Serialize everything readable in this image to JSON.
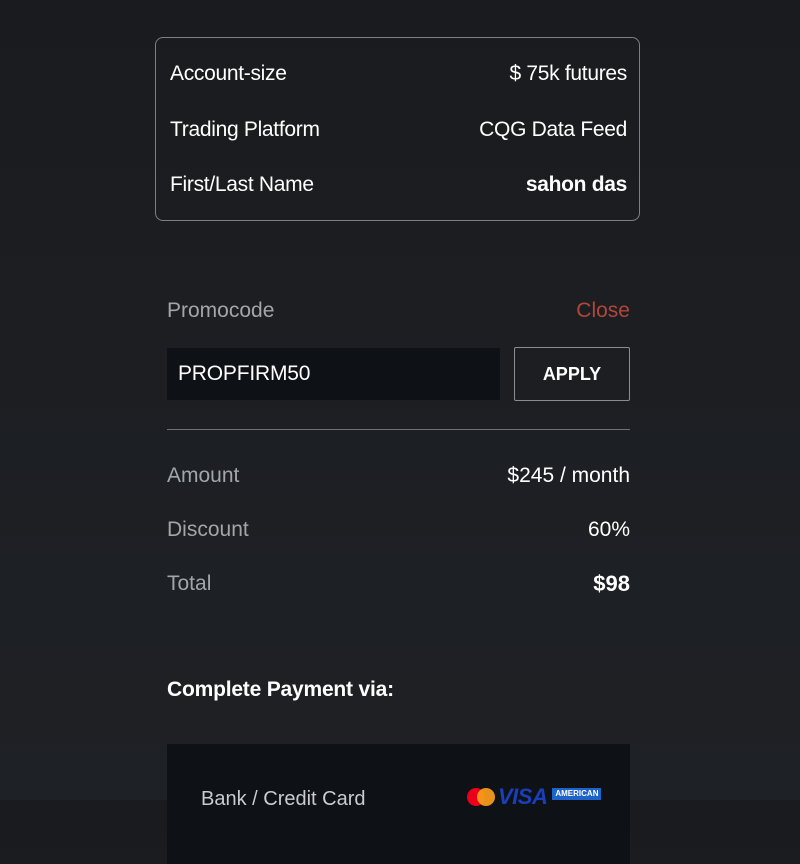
{
  "summary": {
    "rows": [
      {
        "label": "Account-size",
        "value": "$ 75k futures"
      },
      {
        "label": "Trading Platform",
        "value": "CQG Data Feed"
      },
      {
        "label": "First/Last Name",
        "value": "sahon das"
      }
    ]
  },
  "promo": {
    "label": "Promocode",
    "close_label": "Close",
    "input_value": "PROPFIRM50",
    "apply_label": "APPLY"
  },
  "pricing": {
    "amount_label": "Amount",
    "amount_value": "$245 / month",
    "discount_label": "Discount",
    "discount_value": "60%",
    "total_label": "Total",
    "total_value": "$98"
  },
  "payment": {
    "heading": "Complete Payment via:",
    "option_label": "Bank / Credit Card",
    "logos": {
      "visa": "VISA",
      "amex": "AMERICAN"
    }
  },
  "colors": {
    "background": "#1c1e22",
    "close_link": "#b2463a",
    "input_background": "#0e1115",
    "muted_text": "#a3a6a9"
  }
}
